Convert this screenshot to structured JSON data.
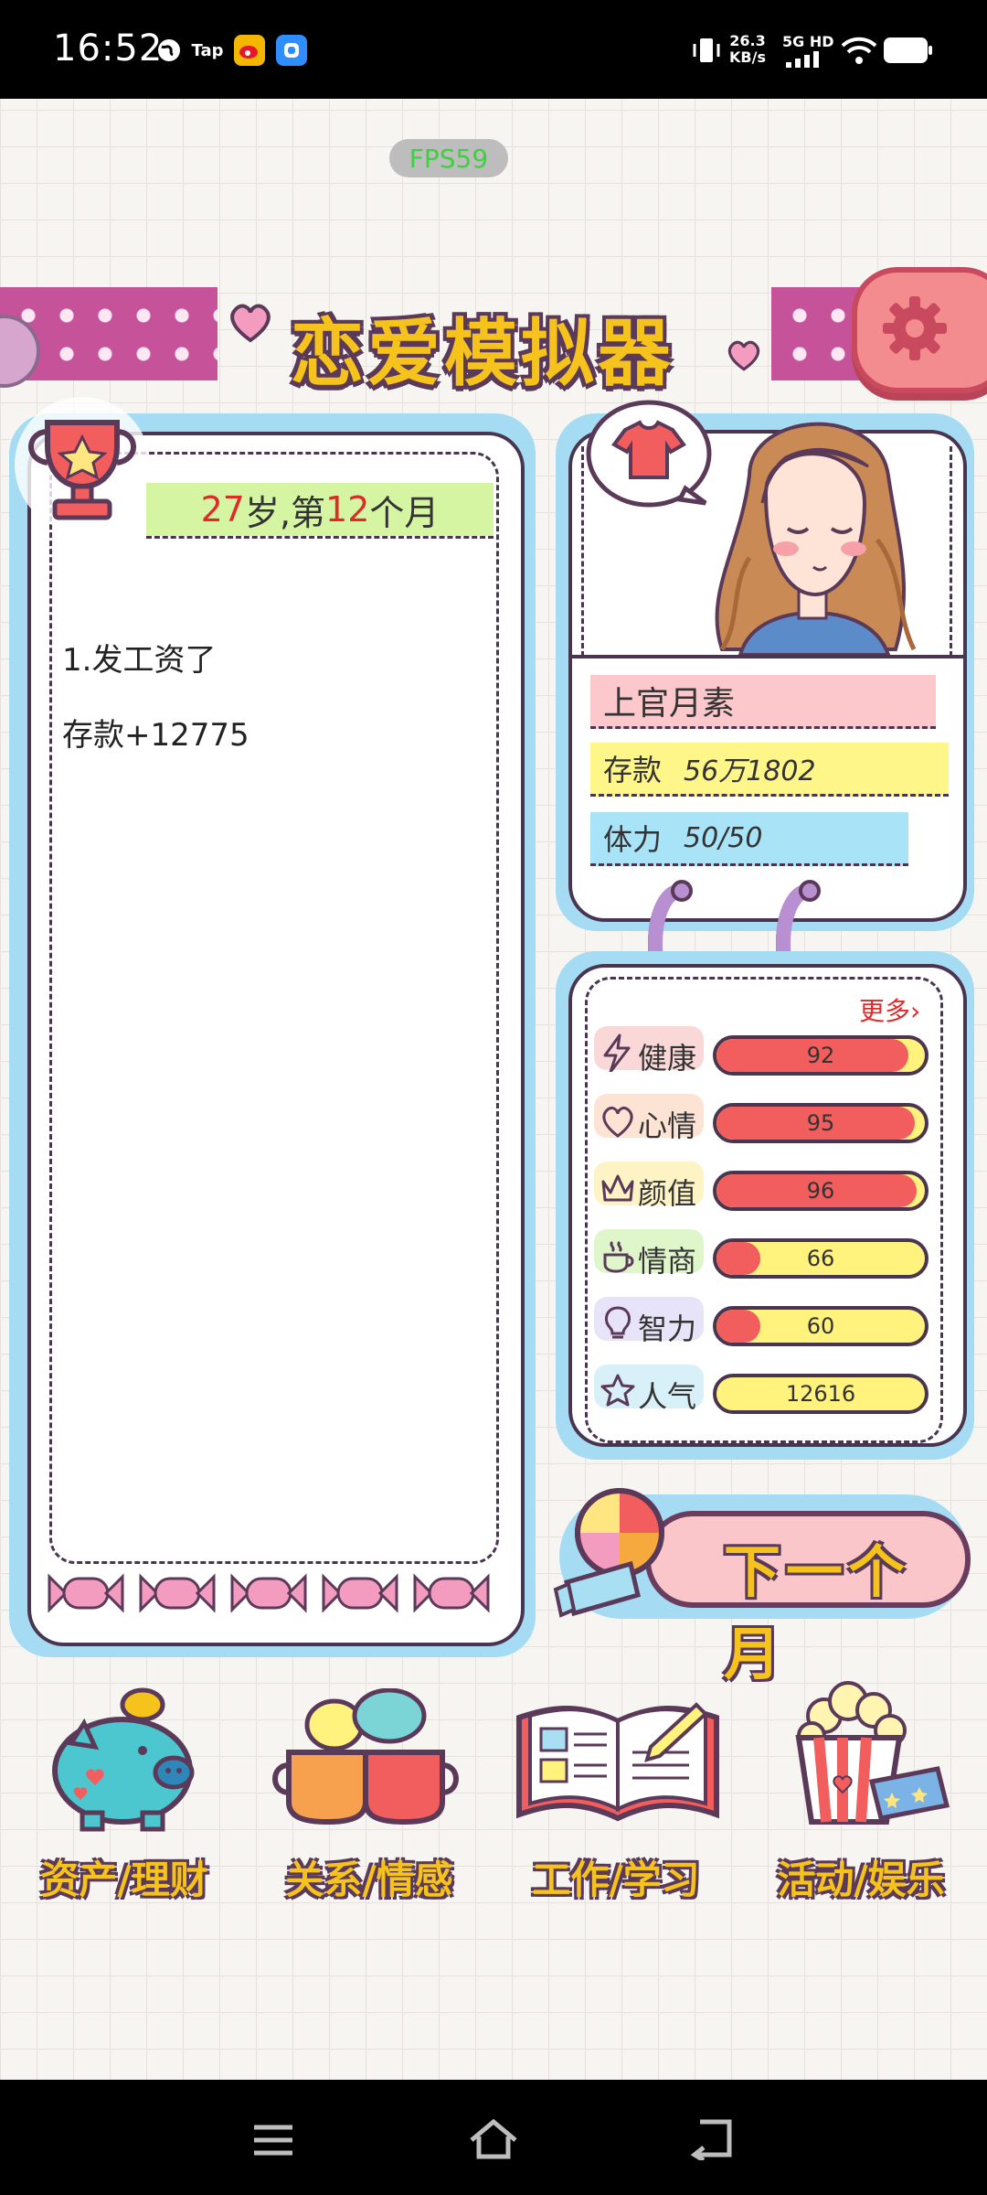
{
  "status_bar": {
    "time": "16:52",
    "app_icons": [
      "globe-icon",
      "tap-icon",
      "weibo-icon",
      "cloud-icon"
    ],
    "speed_value": "26.3",
    "speed_unit": "KB/s",
    "network": "5G HD"
  },
  "fps": "FPS59",
  "title": "恋爱模拟器",
  "event_log": {
    "age": "27",
    "age_suffix": "岁,第",
    "month": "12",
    "month_suffix": "个月",
    "lines": [
      "1.发工资了",
      "存款+12775"
    ]
  },
  "profile": {
    "name": "上官月素",
    "savings_label": "存款",
    "savings_value": "56万1802",
    "stamina_label": "体力",
    "stamina_value": "50/50"
  },
  "stats": {
    "more_label": "更多›",
    "items": [
      {
        "label": "健康",
        "icon": "lightning-icon",
        "value": "92",
        "fill": 0.92,
        "tag_color": "#f7a8a8"
      },
      {
        "label": "心情",
        "icon": "heart-icon",
        "value": "95",
        "fill": 0.95,
        "tag_color": "#f9c29e"
      },
      {
        "label": "颜值",
        "icon": "crown-icon",
        "value": "96",
        "fill": 0.96,
        "tag_color": "#fbe47f"
      },
      {
        "label": "情商",
        "icon": "teacup-icon",
        "value": "66",
        "fill": 0.18,
        "tag_color": "#b9ea8c"
      },
      {
        "label": "智力",
        "icon": "lightbulb-icon",
        "value": "60",
        "fill": 0.18,
        "tag_color": "#c9c2f2"
      },
      {
        "label": "人气",
        "icon": "star-icon",
        "value": "12616",
        "fill": 0,
        "tag_color": "#a8dff2"
      }
    ]
  },
  "next_month_label": "下一个月",
  "bottom_nav": [
    {
      "label": "资产/理财",
      "icon": "piggy-bank-icon"
    },
    {
      "label": "关系/情感",
      "icon": "mugs-icon"
    },
    {
      "label": "工作/学习",
      "icon": "book-pencil-icon"
    },
    {
      "label": "活动/娱乐",
      "icon": "popcorn-icon"
    }
  ],
  "colors": {
    "accent_yellow": "#f6c21c",
    "outline_purple": "#4a3550",
    "bar_red": "#f25d5d",
    "bar_yellow": "#fff37e",
    "frame_blue": "#a6dcf3"
  }
}
